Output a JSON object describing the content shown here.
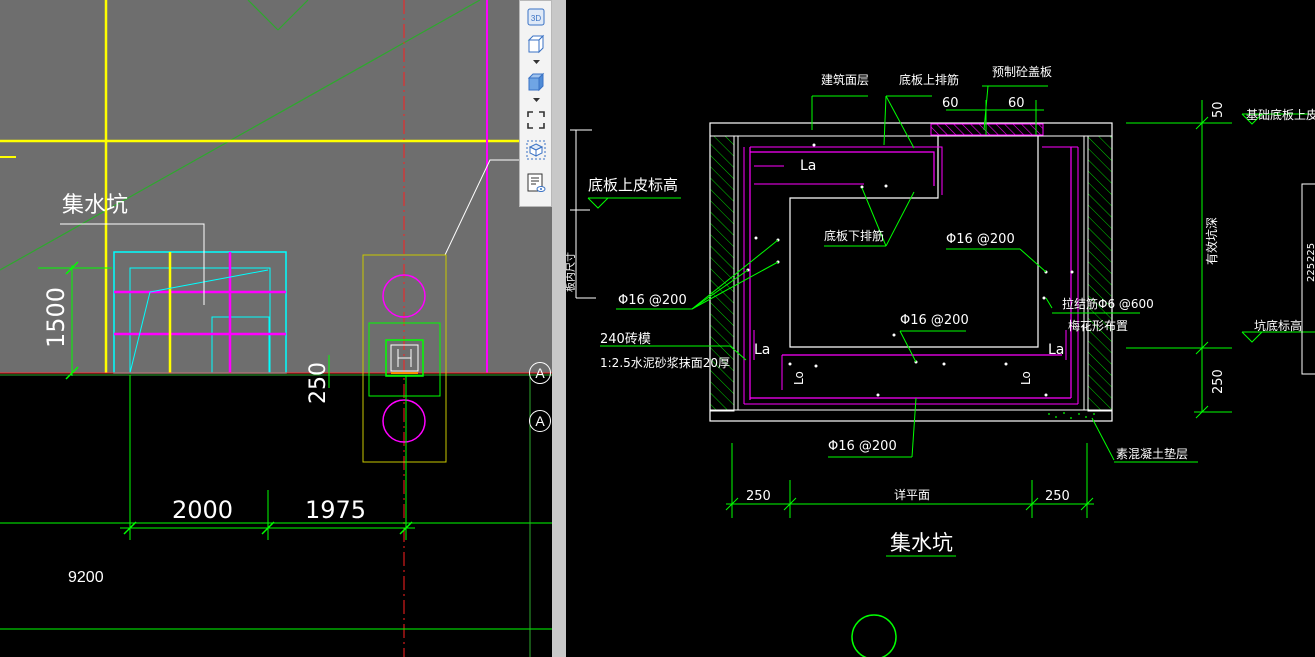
{
  "left_view": {
    "room_label": "集水坑",
    "dim_height": "1500",
    "dim_offset": "250",
    "dim_span_1": "2000",
    "dim_span_2": "1975",
    "total_length": "9200",
    "axis_a_top": "A",
    "axis_a_bottom": "A",
    "colors": {
      "viewport_bg": "#6e6e6e",
      "grid": "#ffff00",
      "wall": "#ff00ff",
      "pit": "#00ffff",
      "dim": "#00ff00",
      "axis": "#ff0000"
    }
  },
  "view_toolbar": {
    "items": [
      {
        "icon": "3d-view-icon",
        "label": "3D"
      },
      {
        "icon": "box-view-icon"
      },
      {
        "icon": "solid-box-view-icon"
      },
      {
        "icon": "fit-window-icon"
      },
      {
        "icon": "rotate-cube-icon"
      },
      {
        "icon": "property-list-icon"
      }
    ]
  },
  "detail": {
    "labels": {
      "building_surface": "建筑面层",
      "top_rebar": "底板上排筋",
      "precast_cover": "预制砼盖板",
      "dim_60_a": "60",
      "dim_60_b": "60",
      "dim_50": "50",
      "foundation_top": "基础底板上皮",
      "slab_top_elev": "底板上皮标高",
      "bottom_rebar": "底板下排筋",
      "rebar_phi16_a": "Φ16 @200",
      "rebar_phi16_b": "Φ16 @200",
      "rebar_phi16_c": "Φ16 @200",
      "rebar_phi16_d": "Φ16 @200",
      "tie_rebar": "拉结筋Φ6 @600",
      "plum_layout": "梅花形布置",
      "brick_mold": "240砖模",
      "mortar": "1:2.5水泥砂浆抹面20厚",
      "la_1": "La",
      "la_2": "La",
      "la_3": "La",
      "lo_1": "Lo",
      "lo_2": "Lo",
      "effective_depth": "有效坑深",
      "pit_bottom_elev": "坑底标高",
      "dim_250_v": "250",
      "concrete_cushion": "素混凝土垫层",
      "dim_250_l": "250",
      "detail_plan": "详平面",
      "dim_250_r": "250",
      "title": "集水坑",
      "side_tag": "板内尺寸",
      "edge_dim_a": "225",
      "edge_dim_b": "225"
    },
    "colors": {
      "outline": "#ffffff",
      "rebar": "#ff00ff",
      "leader": "#00ff00",
      "hatch": "#00ff00",
      "cover": "#ff00ff"
    }
  }
}
